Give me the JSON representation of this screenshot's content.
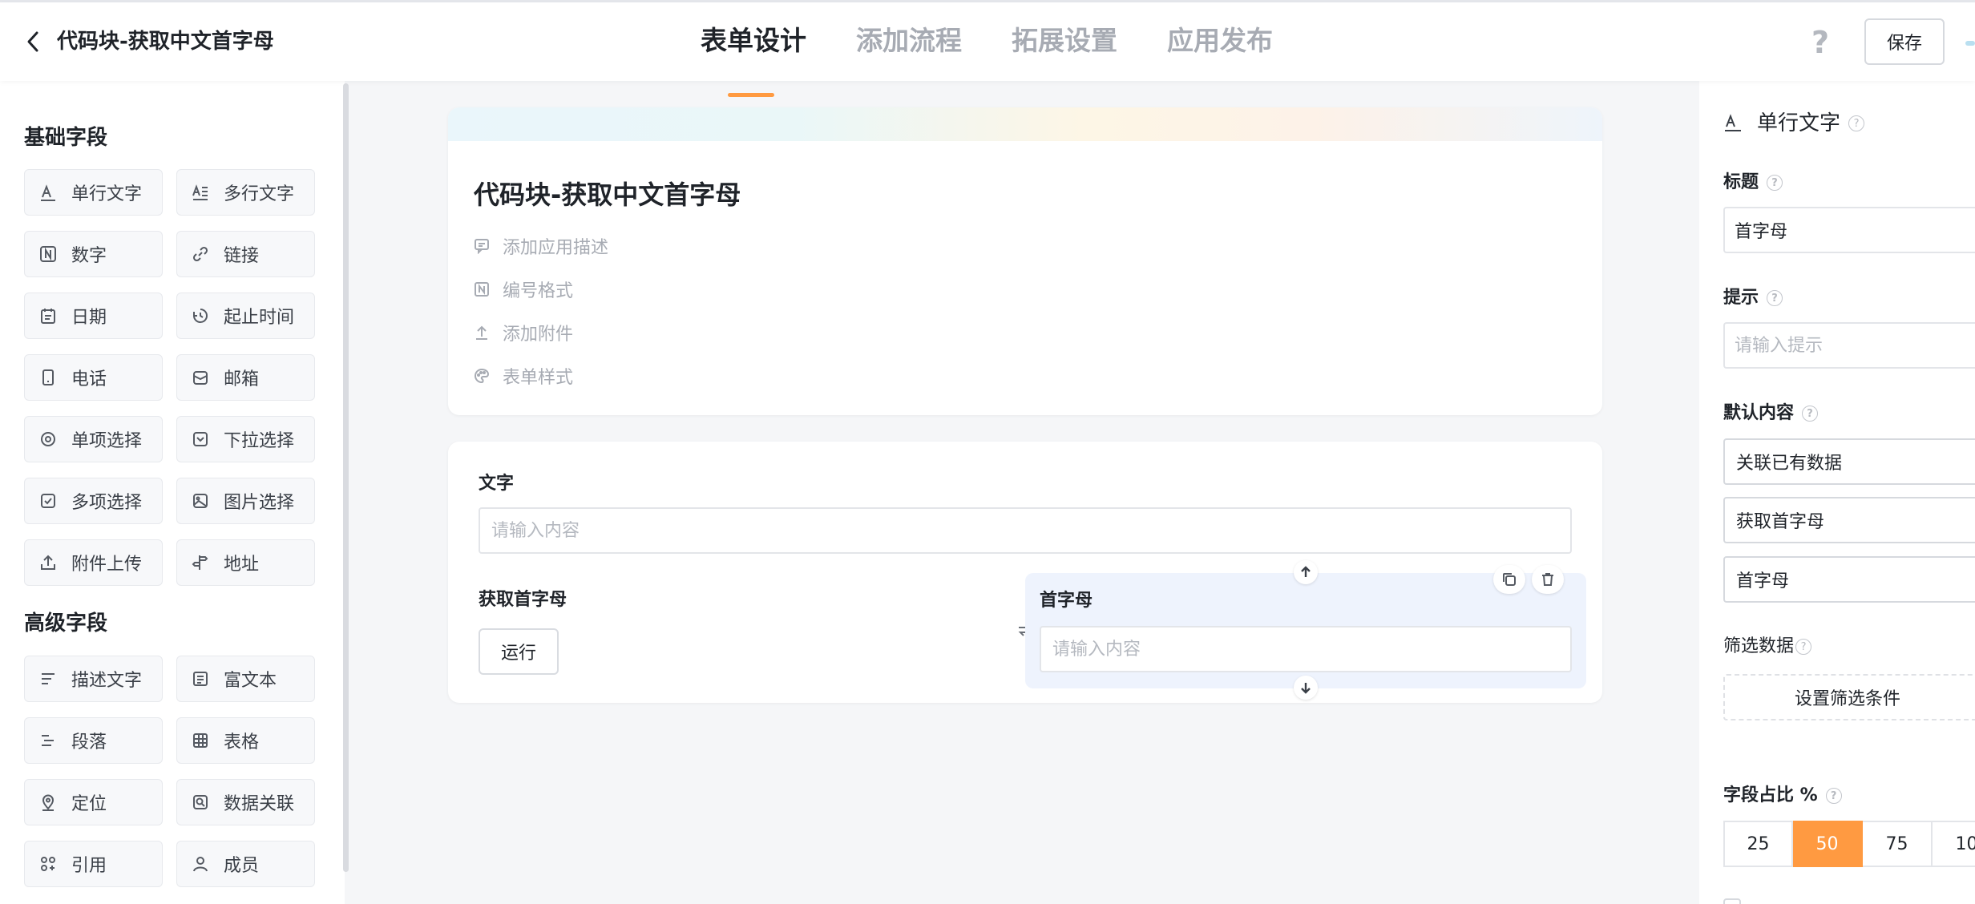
{
  "app": {
    "title": "代码块-获取中文首字母"
  },
  "tabs": [
    {
      "label": "表单设计",
      "active": true
    },
    {
      "label": "添加流程",
      "active": false
    },
    {
      "label": "拓展设置",
      "active": false
    },
    {
      "label": "应用发布",
      "active": false
    }
  ],
  "header": {
    "help": "?",
    "save": "保存"
  },
  "palette": {
    "basic_title": "基础字段",
    "advanced_title": "高级字段",
    "basic": [
      {
        "label": "单行文字",
        "icon": "text-icon"
      },
      {
        "label": "多行文字",
        "icon": "multiline-text-icon"
      },
      {
        "label": "数字",
        "icon": "number-icon"
      },
      {
        "label": "链接",
        "icon": "link-icon"
      },
      {
        "label": "日期",
        "icon": "calendar-icon"
      },
      {
        "label": "起止时间",
        "icon": "time-range-icon"
      },
      {
        "label": "电话",
        "icon": "phone-icon"
      },
      {
        "label": "邮箱",
        "icon": "mail-icon"
      },
      {
        "label": "单项选择",
        "icon": "radio-icon"
      },
      {
        "label": "下拉选择",
        "icon": "dropdown-icon"
      },
      {
        "label": "多项选择",
        "icon": "checkbox-icon"
      },
      {
        "label": "图片选择",
        "icon": "image-icon"
      },
      {
        "label": "附件上传",
        "icon": "upload-icon"
      },
      {
        "label": "地址",
        "icon": "address-icon"
      }
    ],
    "advanced": [
      {
        "label": "描述文字",
        "icon": "description-icon"
      },
      {
        "label": "富文本",
        "icon": "rich-text-icon"
      },
      {
        "label": "段落",
        "icon": "paragraph-icon"
      },
      {
        "label": "表格",
        "icon": "table-icon"
      },
      {
        "label": "定位",
        "icon": "location-icon"
      },
      {
        "label": "数据关联",
        "icon": "data-link-icon"
      },
      {
        "label": "引用",
        "icon": "reference-icon"
      },
      {
        "label": "成员",
        "icon": "member-icon"
      }
    ]
  },
  "form": {
    "title": "代码块-获取中文首字母",
    "meta": [
      {
        "label": "添加应用描述",
        "icon": "comment-icon"
      },
      {
        "label": "编号格式",
        "icon": "number-format-icon"
      },
      {
        "label": "添加附件",
        "icon": "attach-icon"
      },
      {
        "label": "表单样式",
        "icon": "palette-icon"
      }
    ],
    "fields": {
      "text_label": "文字",
      "text_placeholder": "请输入内容",
      "code_label": "获取首字母",
      "run_label": "运行",
      "initial_label": "首字母",
      "initial_placeholder": "请输入内容"
    }
  },
  "props": {
    "type_title": "单行文字",
    "title_label": "标题",
    "title_value": "首字母",
    "hint_label": "提示",
    "hint_placeholder": "请输入提示",
    "default_label": "默认内容",
    "default_source": "关联已有数据",
    "default_form": "获取首字母",
    "default_field": "首字母",
    "filter_label": "筛选数据",
    "filter_button": "设置筛选条件",
    "ratio_label": "字段占比 %",
    "ratio_options": [
      "25",
      "50",
      "75",
      "10"
    ],
    "ratio_selected": "50"
  },
  "colors": {
    "accent": "#ff9a41",
    "selected_block": "#eef3fd"
  }
}
